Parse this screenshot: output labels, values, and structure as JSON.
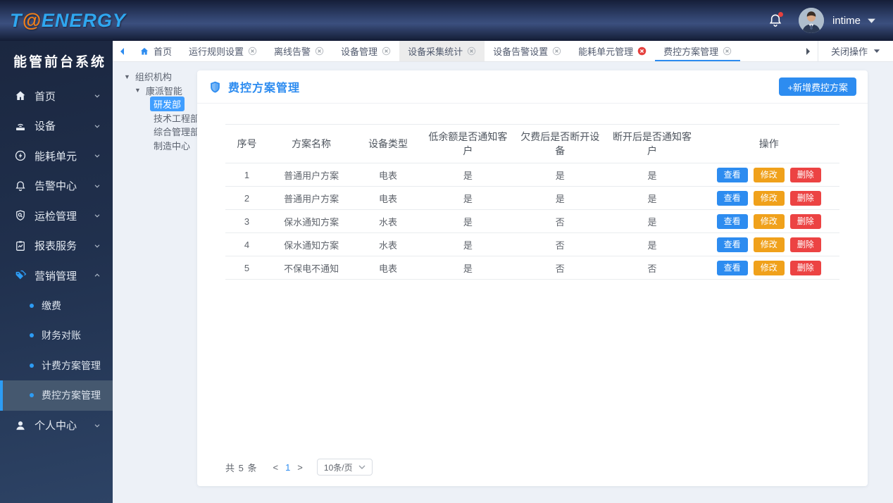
{
  "header": {
    "logo_t": "T",
    "logo_at": "@",
    "logo_energy": "ENERGY",
    "username": "intime"
  },
  "sidebar": {
    "title": "能管前台系统",
    "items": [
      {
        "key": "home",
        "icon": "home-icon",
        "label": "首页"
      },
      {
        "key": "device",
        "icon": "device-icon",
        "label": "设备"
      },
      {
        "key": "energy-unit",
        "icon": "energy-icon",
        "label": "能耗单元"
      },
      {
        "key": "alarm-center",
        "icon": "alarm-icon",
        "label": "告警中心"
      },
      {
        "key": "inspection",
        "icon": "inspection-icon",
        "label": "运检管理"
      },
      {
        "key": "report",
        "icon": "report-icon",
        "label": "报表服务"
      },
      {
        "key": "marketing",
        "icon": "marketing-icon",
        "label": "营销管理",
        "expanded": true,
        "accent": true
      }
    ],
    "subitems": [
      {
        "key": "payment",
        "label": "缴费"
      },
      {
        "key": "finance-reconcile",
        "label": "财务对账"
      },
      {
        "key": "billing-plan-mgmt",
        "label": "计费方案管理"
      },
      {
        "key": "fee-control-plan-mgmt",
        "label": "费控方案管理",
        "selected": true
      }
    ],
    "personal": {
      "key": "personal-center",
      "icon": "user-icon",
      "label": "个人中心"
    }
  },
  "tabbar": {
    "tabs": [
      {
        "key": "home",
        "label": "首页",
        "home_icon": true,
        "closable": false
      },
      {
        "key": "run-rule-settings",
        "label": "运行规则设置",
        "closable": true
      },
      {
        "key": "offline-alarm",
        "label": "离线告警",
        "closable": true
      },
      {
        "key": "device-mgmt",
        "label": "设备管理",
        "closable": true
      },
      {
        "key": "device-collect-stats",
        "label": "设备采集统计",
        "closable": true,
        "highlight": true
      },
      {
        "key": "device-alarm-settings",
        "label": "设备告警设置",
        "closable": true
      },
      {
        "key": "energy-unit-mgmt",
        "label": "能耗单元管理",
        "closable": true,
        "close_style": "red"
      },
      {
        "key": "fee-control-plan-mgmt",
        "label": "费控方案管理",
        "closable": true,
        "active": true
      }
    ],
    "close_menu": "关闭操作"
  },
  "tree": {
    "root": "组织机构",
    "company": "康派智能",
    "departments": [
      {
        "key": "rd-dept",
        "label": "研发部",
        "selected": true
      },
      {
        "key": "tech-eng-dept",
        "label": "技术工程部"
      },
      {
        "key": "general-mgmt",
        "label": "综合管理部"
      },
      {
        "key": "manufacturing",
        "label": "制造中心"
      }
    ]
  },
  "main": {
    "title": "费控方案管理",
    "add_button": "+新增费控方案",
    "table": {
      "headers": [
        "序号",
        "方案名称",
        "设备类型",
        "低余额是否通知客户",
        "欠费后是否断开设备",
        "断开后是否通知客户",
        "操作"
      ],
      "rows": [
        [
          "1",
          "普通用户方案",
          "电表",
          "是",
          "是",
          "是"
        ],
        [
          "2",
          "普通用户方案",
          "电表",
          "是",
          "是",
          "是"
        ],
        [
          "3",
          "保水通知方案",
          "水表",
          "是",
          "否",
          "是"
        ],
        [
          "4",
          "保水通知方案",
          "水表",
          "是",
          "否",
          "是"
        ],
        [
          "5",
          "不保电不通知",
          "电表",
          "是",
          "否",
          "否"
        ]
      ],
      "actions": [
        "查看",
        "修改",
        "删除"
      ]
    },
    "pagination": {
      "total": "共 5 条",
      "page": "1",
      "page_size": "10条/页"
    }
  },
  "colors": {
    "accent": "#2d8cf0",
    "tree_selected": "#409eff",
    "edit_orange": "#f0a11b",
    "delete_red": "#ec4343",
    "tab_close_red": "#e5413e",
    "header_navy": "#334672",
    "sidebar_navy": "#20304d",
    "logo_blue": "#2fa7f0",
    "logo_orange": "#f07f1a"
  }
}
